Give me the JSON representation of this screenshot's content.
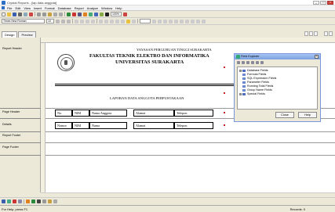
{
  "window": {
    "title": "Crystal Reports - [lap data anggota]"
  },
  "menu": [
    "File",
    "Edit",
    "View",
    "Insert",
    "Format",
    "Database",
    "Report",
    "Analyze",
    "Window",
    "Help"
  ],
  "toolbar": {
    "font_name": "Times New Roman",
    "font_size": "10",
    "zoom": "100%"
  },
  "tabs": [
    "Design",
    "Preview"
  ],
  "sections": [
    {
      "label": "Report Header"
    },
    {
      "label": "Page Header"
    },
    {
      "label": "Details"
    },
    {
      "label": "Report Footer"
    },
    {
      "label": "Page Footer"
    }
  ],
  "report": {
    "foundation": "YAYASAN PERGURUAN TINGGI SURAKARTA",
    "faculty": "FAKULTAS TEKNIK ELEKTRO DAN INFORMATIKA",
    "university": "UNIVERSITAS SURAKARTA",
    "report_title": "LAPORAN DATA ANGGOTA PERPUSTAKAAN",
    "headers": [
      "No.",
      "NIM",
      "Nama Anggota",
      "Alamat",
      "Telepon"
    ],
    "fields": [
      "Nomor",
      "NIM",
      "Nama",
      "Alamat",
      "Telepon"
    ]
  },
  "field_explorer": {
    "title": "Field Explorer",
    "items": [
      "Database Fields",
      "Formula Fields",
      "SQL Expression Fields",
      "Parameter Fields",
      "Running Total Fields",
      "Group Name Fields",
      "Special Fields"
    ],
    "close_label": "Close",
    "help_label": "Help"
  },
  "status": {
    "left": "For Help, press F1",
    "right": "Records: 0"
  }
}
